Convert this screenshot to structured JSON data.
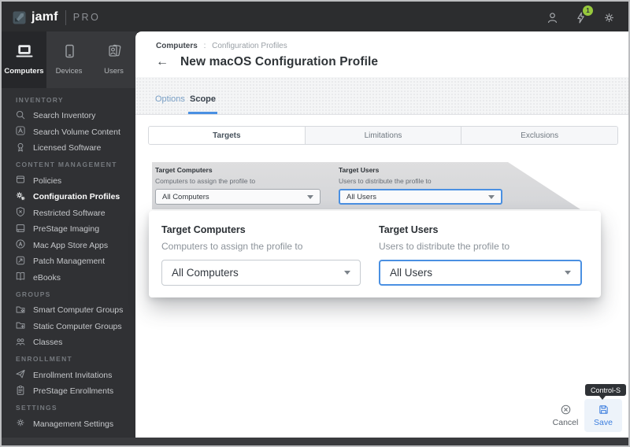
{
  "topbar": {
    "brand": "jamf",
    "brand_suffix": "PRO",
    "notification_badge": "1"
  },
  "main_tabs": [
    {
      "label": "Computers",
      "icon": "laptop",
      "active": true
    },
    {
      "label": "Devices",
      "icon": "tablet",
      "active": false
    },
    {
      "label": "Users",
      "icon": "users-card",
      "active": false
    }
  ],
  "sidebar": {
    "sections": [
      {
        "header": "INVENTORY",
        "items": [
          {
            "label": "Search Inventory",
            "icon": "search",
            "active": false
          },
          {
            "label": "Search Volume Content",
            "icon": "box-a",
            "active": false
          },
          {
            "label": "Licensed Software",
            "icon": "award",
            "active": false
          }
        ]
      },
      {
        "header": "CONTENT MANAGEMENT",
        "items": [
          {
            "label": "Policies",
            "icon": "policies",
            "active": false
          },
          {
            "label": "Configuration Profiles",
            "icon": "gears",
            "active": true
          },
          {
            "label": "Restricted Software",
            "icon": "shield-x",
            "active": false
          },
          {
            "label": "PreStage Imaging",
            "icon": "imaging",
            "active": false
          },
          {
            "label": "Mac App Store Apps",
            "icon": "app-store",
            "active": false
          },
          {
            "label": "Patch Management",
            "icon": "patch",
            "active": false
          },
          {
            "label": "eBooks",
            "icon": "book",
            "active": false
          }
        ]
      },
      {
        "header": "GROUPS",
        "items": [
          {
            "label": "Smart Computer Groups",
            "icon": "folder-gear",
            "active": false
          },
          {
            "label": "Static Computer Groups",
            "icon": "folder-plus",
            "active": false
          },
          {
            "label": "Classes",
            "icon": "people",
            "active": false
          }
        ]
      },
      {
        "header": "ENROLLMENT",
        "items": [
          {
            "label": "Enrollment Invitations",
            "icon": "paper-plane",
            "active": false
          },
          {
            "label": "PreStage Enrollments",
            "icon": "clipboard",
            "active": false
          }
        ]
      },
      {
        "header": "SETTINGS",
        "items": [
          {
            "label": "Management Settings",
            "icon": "gear",
            "active": false
          }
        ]
      }
    ]
  },
  "breadcrumb": {
    "root": "Computers",
    "separator": ":",
    "current": "Configuration Profiles"
  },
  "page": {
    "title": "New macOS Configuration Profile",
    "back_glyph": "←"
  },
  "profile_tabs": [
    {
      "label": "Options",
      "active": false
    },
    {
      "label": "Scope",
      "active": true
    }
  ],
  "scope_tabs": [
    {
      "label": "Targets",
      "active": true
    },
    {
      "label": "Limitations",
      "active": false
    },
    {
      "label": "Exclusions",
      "active": false
    }
  ],
  "scope_form": {
    "target_computers": {
      "label": "Target Computers",
      "description": "Computers to assign the profile to",
      "value": "All Computers"
    },
    "target_users": {
      "label": "Target Users",
      "description": "Users to distribute the profile to",
      "value": "All Users"
    }
  },
  "actions": {
    "cancel_label": "Cancel",
    "save_label": "Save",
    "save_shortcut_tooltip": "Control-S"
  },
  "colors": {
    "accent_blue": "#4a90e2",
    "save_blue": "#3c7ede",
    "badge_green": "#97c93d",
    "topbar_dark": "#2c2d2f",
    "sidebar_dark": "#303134"
  }
}
